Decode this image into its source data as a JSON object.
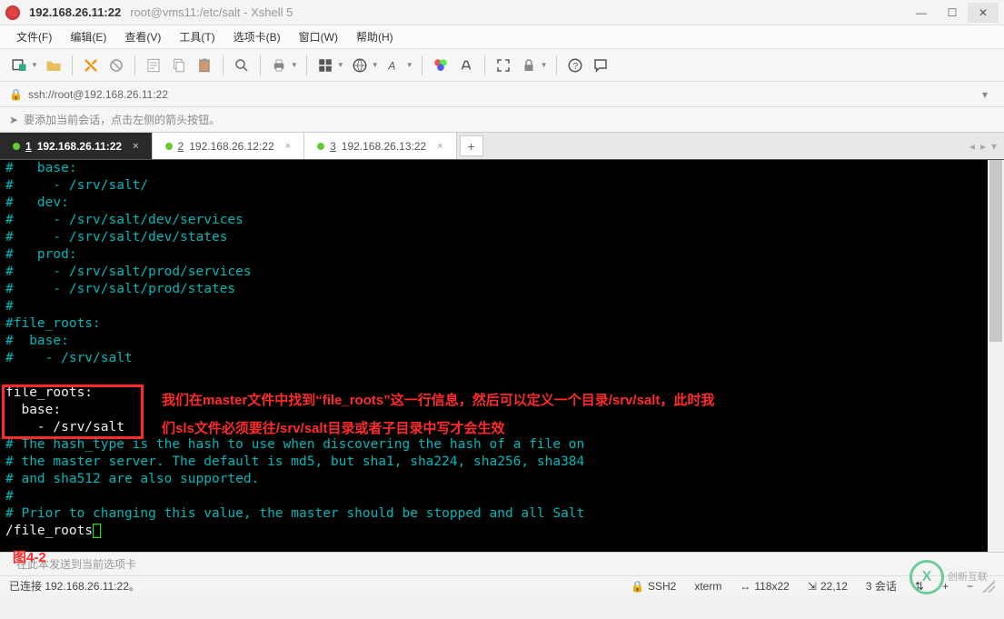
{
  "window": {
    "title_main": "192.168.26.11:22",
    "title_sub": "root@vms11:/etc/salt - Xshell 5"
  },
  "menu": {
    "file": "文件(F)",
    "edit": "编辑(E)",
    "view": "查看(V)",
    "tools": "工具(T)",
    "tabs": "选项卡(B)",
    "window": "窗口(W)",
    "help": "帮助(H)"
  },
  "address": {
    "url": "ssh://root@192.168.26.11:22"
  },
  "hint": {
    "text": "要添加当前会话，点击左侧的箭头按钮。"
  },
  "tabs": {
    "t1": {
      "num": "1",
      "label": "192.168.26.11:22"
    },
    "t2": {
      "num": "2",
      "label": "192.168.26.12:22"
    },
    "t3": {
      "num": "3",
      "label": "192.168.26.13:22"
    }
  },
  "terminal": {
    "lines": [
      {
        "c": "cyan",
        "t": "#   base:"
      },
      {
        "c": "cyan",
        "t": "#     - /srv/salt/"
      },
      {
        "c": "cyan",
        "t": "#   dev:"
      },
      {
        "c": "cyan",
        "t": "#     - /srv/salt/dev/services"
      },
      {
        "c": "cyan",
        "t": "#     - /srv/salt/dev/states"
      },
      {
        "c": "cyan",
        "t": "#   prod:"
      },
      {
        "c": "cyan",
        "t": "#     - /srv/salt/prod/services"
      },
      {
        "c": "cyan",
        "t": "#     - /srv/salt/prod/states"
      },
      {
        "c": "cyan",
        "t": "#"
      },
      {
        "c": "cyan",
        "t": "#file_roots:"
      },
      {
        "c": "cyan",
        "t": "#  base:"
      },
      {
        "c": "cyan",
        "t": "#    - /srv/salt"
      },
      {
        "c": "cyan",
        "t": ""
      },
      {
        "c": "white",
        "t": "file_roots:"
      },
      {
        "c": "white",
        "t": "  base:"
      },
      {
        "c": "white",
        "t": "    - /srv/salt"
      },
      {
        "c": "cyan",
        "t": "# The hash_type is the hash to use when discovering the hash of a file on"
      },
      {
        "c": "cyan",
        "t": "# the master server. The default is md5, but sha1, sha224, sha256, sha384"
      },
      {
        "c": "cyan",
        "t": "# and sha512 are also supported."
      },
      {
        "c": "cyan",
        "t": "#"
      },
      {
        "c": "cyan",
        "t": "# Prior to changing this value, the master should be stopped and all Salt"
      }
    ],
    "search_line": "/file_roots",
    "annotation_l1": "我们在master文件中找到“file_roots”这一行信息，然后可以定义一个目录/srv/salt，此时我",
    "annotation_l2": "们sls文件必须要往/srv/salt目录或者子目录中写才会生效",
    "fig_label": "图4-2"
  },
  "input_hint": "在此本发送到当前选项卡",
  "status": {
    "conn": "已连接 192.168.26.11:22。",
    "proto": "SSH2",
    "term": "xterm",
    "size": "118x22",
    "pos": "22,12",
    "sessions": "3 会话"
  },
  "watermark": {
    "brand": "创新互联"
  }
}
